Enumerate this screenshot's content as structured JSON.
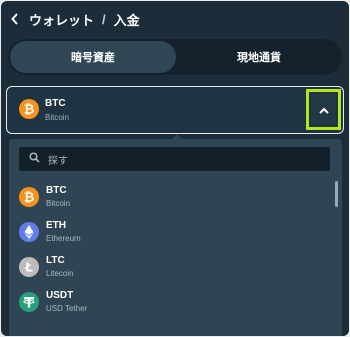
{
  "header": {
    "back_label": "ウォレット",
    "separator": "/",
    "current": "入金"
  },
  "tabs": [
    {
      "label": "暗号資産",
      "active": true
    },
    {
      "label": "現地通貨",
      "active": false
    }
  ],
  "selected": {
    "symbol": "BTC",
    "name": "Bitcoin",
    "icon": "bitcoin-icon",
    "expanded": true
  },
  "search": {
    "placeholder": "探す"
  },
  "currencies": [
    {
      "symbol": "BTC",
      "name": "Bitcoin",
      "icon": "bitcoin-icon",
      "color": "#f7931a"
    },
    {
      "symbol": "ETH",
      "name": "Ethereum",
      "icon": "ethereum-icon",
      "color": "#627eea"
    },
    {
      "symbol": "LTC",
      "name": "Litecoin",
      "icon": "litecoin-icon",
      "color": "#bfbbbb"
    },
    {
      "symbol": "USDT",
      "name": "USD Tether",
      "icon": "tether-icon",
      "color": "#26a17b"
    }
  ],
  "colors": {
    "panel_bg": "#1c2c38",
    "dropdown_bg": "#2f4553",
    "highlight": "#b5e61d"
  }
}
